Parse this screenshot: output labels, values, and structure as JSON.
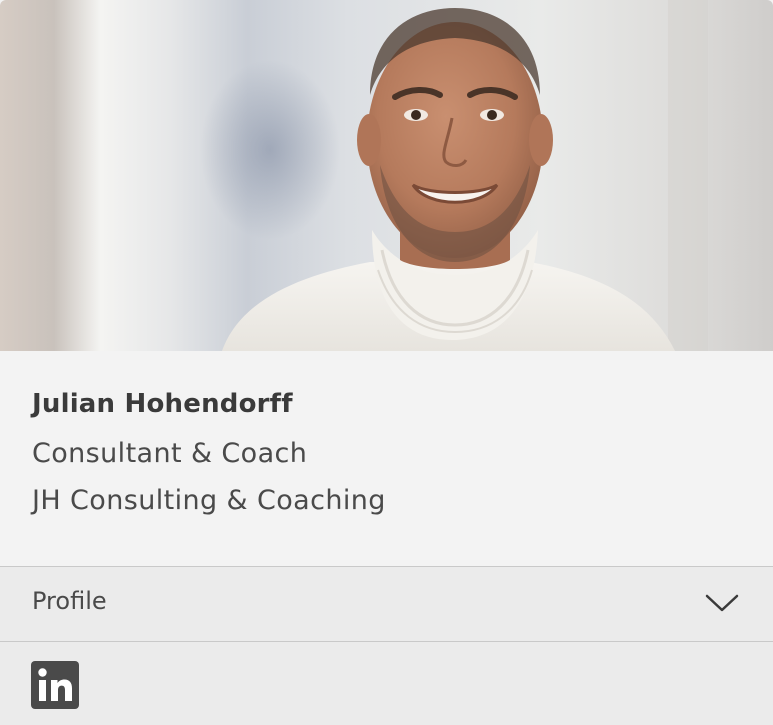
{
  "person": {
    "name": "Julian Hohendorff",
    "role": "Consultant & Coach",
    "company": "JH Consulting & Coaching",
    "photo_description": "portrait photo"
  },
  "profile": {
    "label": "Profile",
    "expanded": false
  },
  "social": {
    "linkedin_icon": "linkedin-icon"
  },
  "colors": {
    "card_background": "#f3f3f3",
    "accordion_background": "#ebebeb",
    "text": "#4a4a4a",
    "divider": "#c9c9c9",
    "icon": "#4a4a4a"
  }
}
